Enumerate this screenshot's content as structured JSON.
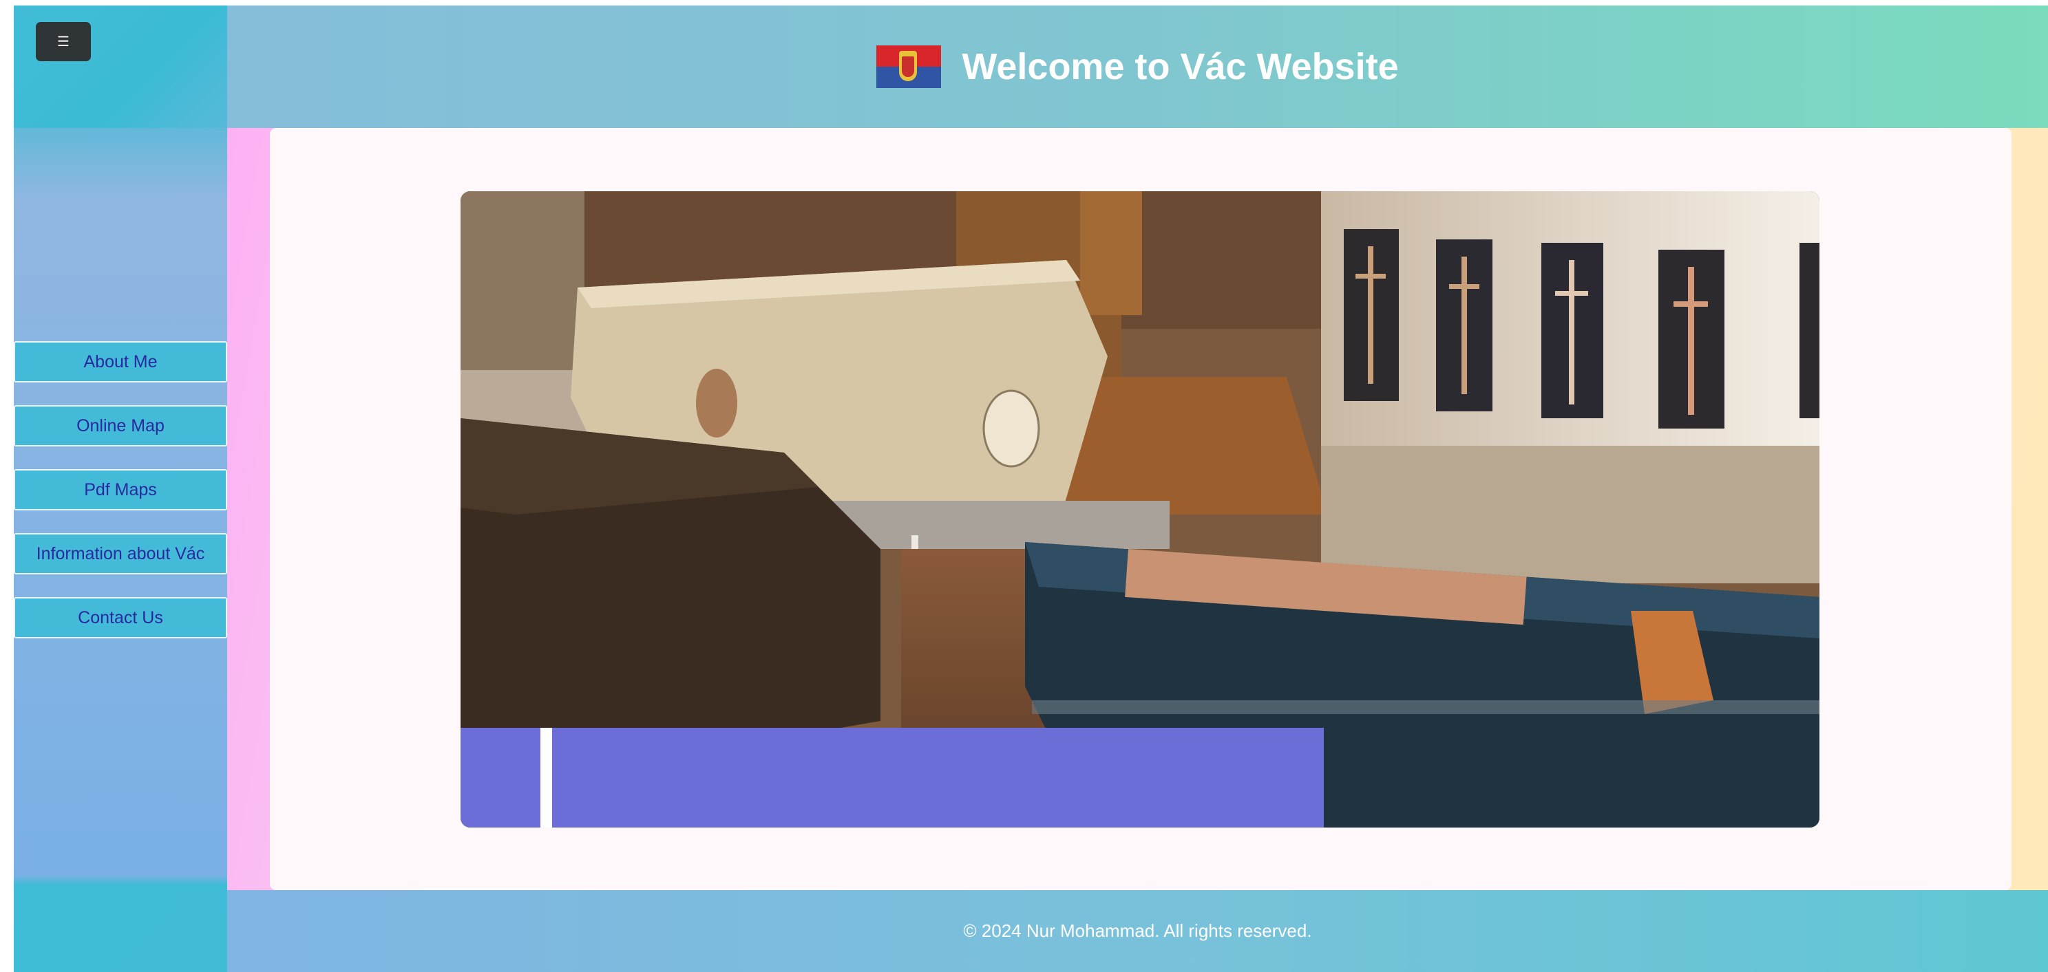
{
  "menu_toggle": {
    "icon": "hamburger-icon",
    "label": "☰"
  },
  "header": {
    "title": "Welcome to Vác Website",
    "flag_icon": "vac-flag-icon"
  },
  "sidebar": {
    "items": [
      {
        "label": "About Me"
      },
      {
        "label": "Online Map"
      },
      {
        "label": "Pdf Maps"
      },
      {
        "label": "Information about Vác"
      },
      {
        "label": "Contact Us"
      }
    ]
  },
  "slideshow": {
    "image_description": "crypt with painted wooden coffins",
    "caption": ""
  },
  "footer": {
    "text": "© 2024 Nur Mohammad. All rights reserved."
  },
  "colors": {
    "sidebar": "#42bad8",
    "nav_text": "#2a2aa0",
    "caption_bar": "#6d6dd8",
    "toggle": "#2f3436"
  }
}
